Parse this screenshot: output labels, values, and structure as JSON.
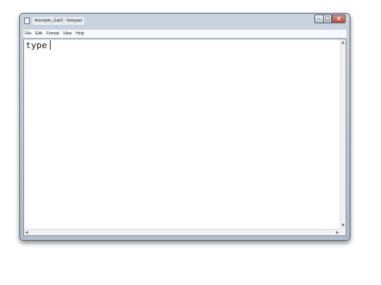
{
  "window": {
    "title": "Animable_Gait2 - Notepad"
  },
  "caption_buttons": {
    "minimize": "–",
    "maximize": "□",
    "close": "x"
  },
  "menu": [
    "File",
    "Edit",
    "Format",
    "View",
    "Help"
  ],
  "editor": {
    "content": "type"
  },
  "icons": {
    "app": "notepad-icon",
    "scroll_up": "arrow-up-icon",
    "scroll_down": "arrow-down-icon",
    "scroll_left": "arrow-left-icon",
    "scroll_right": "arrow-right-icon"
  },
  "colors": {
    "frame": "#b6c3d1",
    "close_button": "#c24a36",
    "editor_bg": "#ffffff"
  }
}
